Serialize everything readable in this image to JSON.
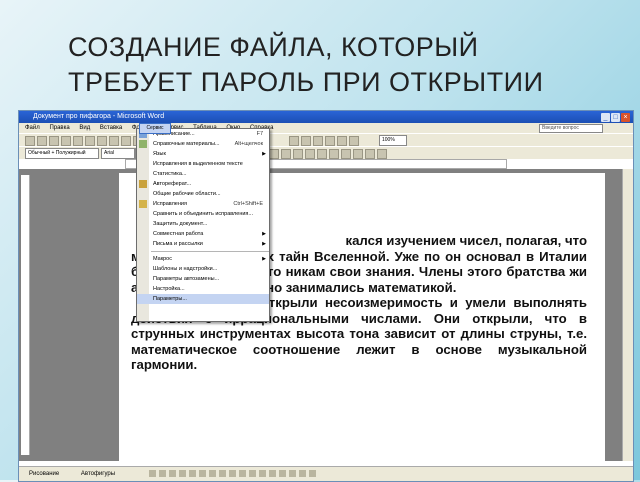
{
  "slide": {
    "title_line1": "СОЗДАНИЕ ФАЙЛА, КОТОРЫЙ",
    "title_line2": "ТРЕБУЕТ ПАРОЛЬ ПРИ ОТКРЫТИИ"
  },
  "window": {
    "title": "Документ про пифагора - Microsoft Word",
    "menus": [
      "Файл",
      "Правка",
      "Вид",
      "Вставка",
      "Формат",
      "Сервис",
      "Таблица",
      "Окно",
      "Справка"
    ],
    "help_placeholder": "Введите вопрос",
    "style_combo": "Обычный + Полужирный",
    "font_combo": "Arial",
    "size_combo": "14",
    "zoom_combo": "100%"
  },
  "tools_menu": {
    "selected": "Сервис",
    "items": [
      {
        "label": "Правописание...",
        "shortcut": "F7"
      },
      {
        "label": "Справочные материалы...",
        "shortcut": "Alt+щелчок"
      },
      {
        "label": "Язык",
        "arrow": true
      },
      {
        "label": "Исправления в выделенном тексте",
        "arrow": false
      },
      {
        "label": "Статистика..."
      },
      {
        "label": "Автореферат..."
      },
      {
        "label": "Общие рабочие области..."
      },
      {
        "label": "Исправления",
        "shortcut": "Ctrl+Shift+E"
      },
      {
        "label": "Сравнить и объединить исправления..."
      },
      {
        "label": "Защитить документ..."
      },
      {
        "label": "Совместная работа",
        "arrow": true
      },
      {
        "label": "Письма и рассылки",
        "arrow": true
      },
      {
        "label": "Макрос",
        "arrow": true
      },
      {
        "label": "Шаблоны и надстройки..."
      },
      {
        "label": "Параметры автозамены..."
      },
      {
        "label": "Настройка..."
      },
      {
        "label": "Параметры..."
      }
    ]
  },
  "document": {
    "p1_line1_right": "кался изучением чисел, полагая, что",
    "p1": "ма                    т разгадки многих тайн Вселенной. Уже по                    он основал в Италии братство, для того что                   никам свои знания. Члены этого братства жи                   аскетично и постоянно занимались математикой.",
    "p2": "Пифагорейцы открыли несоизмеримость и умели выполнять действия с иррациональными числами. Они открыли, что в струнных инструментах высота тона зависит от длины струны, т.е. математическое соотношение лежит в основе музыкальной гармонии."
  },
  "statusbar": {
    "draw_label": "Рисование",
    "autoshapes_label": "Автофигуры"
  }
}
